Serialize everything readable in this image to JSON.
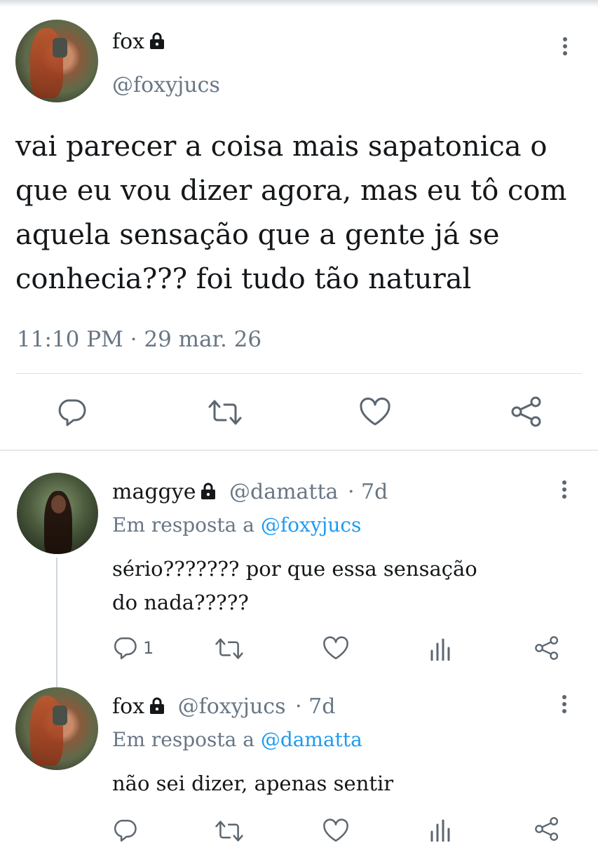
{
  "main_tweet": {
    "display_name": "fox",
    "handle": "@foxyjucs",
    "text": "vai parecer a coisa mais sapatonica o que eu vou dizer agora, mas eu tô com aquela sensação que a gente já se conhecia???  foi tudo tão natural",
    "time": "11:10 PM",
    "date": "29 mar. 26",
    "meta_separator": "·"
  },
  "replies": [
    {
      "display_name": "maggye",
      "handle": "@damatta",
      "age": "· 7d",
      "reply_prefix": "Em resposta a",
      "reply_to": "@foxyjucs",
      "text": "sério??????? por que essa sensação do nada?????",
      "reply_count": "1"
    },
    {
      "display_name": "fox",
      "handle": "@foxyjucs",
      "age": "· 7d",
      "reply_prefix": "Em resposta a",
      "reply_to": "@damatta",
      "text": "não sei dizer, apenas sentir"
    }
  ],
  "icons": {
    "lock": "lock-icon",
    "more": "more-vertical-icon",
    "reply": "reply-icon",
    "retweet": "retweet-icon",
    "like": "heart-icon",
    "analytics": "analytics-icon",
    "share": "share-icon"
  },
  "colors": {
    "text": "#14171a",
    "secondary": "#687684",
    "mention": "#1d9bf0",
    "icon": "#5b6670",
    "divider": "#dfe3e7"
  }
}
